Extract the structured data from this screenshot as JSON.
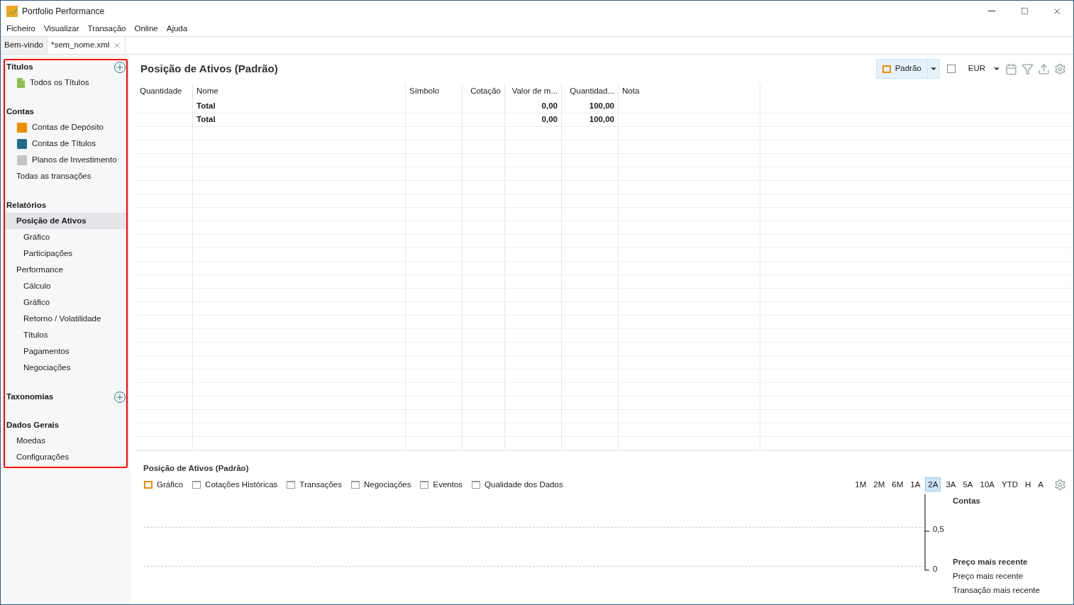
{
  "window": {
    "title": "Portfolio Performance"
  },
  "menu": [
    "Ficheiro",
    "Visualizar",
    "Transação",
    "Online",
    "Ajuda"
  ],
  "tabs": [
    {
      "label": "Bem-vindo",
      "selected": false,
      "closable": false
    },
    {
      "label": "*sem_nome.xml",
      "selected": true,
      "closable": true
    }
  ],
  "sidebar": {
    "sections": [
      {
        "title": "Títulos",
        "add_button": true,
        "items": [
          {
            "label": "Todos os Títulos",
            "kind": "document",
            "selected": false
          }
        ]
      },
      {
        "title": "Contas",
        "add_button": false,
        "items": [
          {
            "label": "Contas de Depósito",
            "kind": "square",
            "color": "#f28c00",
            "selected": false
          },
          {
            "label": "Contas de Títulos",
            "kind": "square",
            "color": "#1f6e8c",
            "selected": false
          },
          {
            "label": "Planos de Investimento",
            "kind": "square",
            "color": "#c4c4c4",
            "selected": false
          },
          {
            "label": "Todas as transações",
            "kind": "plain",
            "selected": false
          }
        ]
      },
      {
        "title": "Relatórios",
        "add_button": false,
        "items": [
          {
            "label": "Posição de Ativos",
            "selected": true,
            "children": [
              {
                "label": "Gráfico",
                "selected": false
              },
              {
                "label": "Participações",
                "selected": false
              }
            ]
          },
          {
            "label": "Performance",
            "selected": false,
            "children": [
              {
                "label": "Cálculo",
                "selected": false
              },
              {
                "label": "Gráfico",
                "selected": false
              },
              {
                "label": "Retorno / Volatilidade",
                "selected": false
              },
              {
                "label": "Títulos",
                "selected": false
              },
              {
                "label": "Pagamentos",
                "selected": false
              },
              {
                "label": "Negociações",
                "selected": false
              }
            ]
          }
        ]
      },
      {
        "title": "Taxonomias",
        "add_button": true
      },
      {
        "title": "Dados Gerais",
        "add_button": false,
        "items": [
          {
            "label": "Moedas",
            "selected": false
          },
          {
            "label": "Configurações",
            "selected": false
          }
        ]
      }
    ]
  },
  "main": {
    "title": "Posição de Ativos (Padrão)",
    "view_button": "Padrão",
    "currency": "EUR",
    "table": {
      "columns": [
        "Quantidade",
        "Nome",
        "Símbolo",
        "Cotação",
        "Valor de m...",
        "Quantidad...",
        "Nota"
      ],
      "rows": [
        [
          "",
          "Total",
          "",
          "",
          "0,00",
          "100,00",
          ""
        ],
        [
          "",
          "Total",
          "",
          "",
          "0,00",
          "100,00",
          ""
        ]
      ]
    }
  },
  "bottom": {
    "title": "Posição de Ativos (Padrão)",
    "views": [
      {
        "label": "Gráfico",
        "selected": true
      },
      {
        "label": "Cotações Históricas",
        "selected": false
      },
      {
        "label": "Transações",
        "selected": false
      },
      {
        "label": "Negociações",
        "selected": false
      },
      {
        "label": "Eventos",
        "selected": false
      },
      {
        "label": "Qualidade dos Dados",
        "selected": false
      }
    ],
    "periods": [
      {
        "label": "1M",
        "selected": false
      },
      {
        "label": "2M",
        "selected": false
      },
      {
        "label": "6M",
        "selected": false
      },
      {
        "label": "1A",
        "selected": false
      },
      {
        "label": "2A",
        "selected": true
      },
      {
        "label": "3A",
        "selected": false
      },
      {
        "label": "5A",
        "selected": false
      },
      {
        "label": "10A",
        "selected": false
      },
      {
        "label": "YTD",
        "selected": false
      },
      {
        "label": "H",
        "selected": false
      },
      {
        "label": "A",
        "selected": false
      }
    ],
    "y_labels": [
      "0,5",
      "0"
    ],
    "legend": [
      {
        "label": "Contas",
        "kind": "heading"
      },
      {
        "label": "Preço mais recente",
        "kind": "heading"
      },
      {
        "label": "Preço mais recente",
        "kind": "entry"
      },
      {
        "label": "Transação mais recente",
        "kind": "entry"
      }
    ]
  }
}
